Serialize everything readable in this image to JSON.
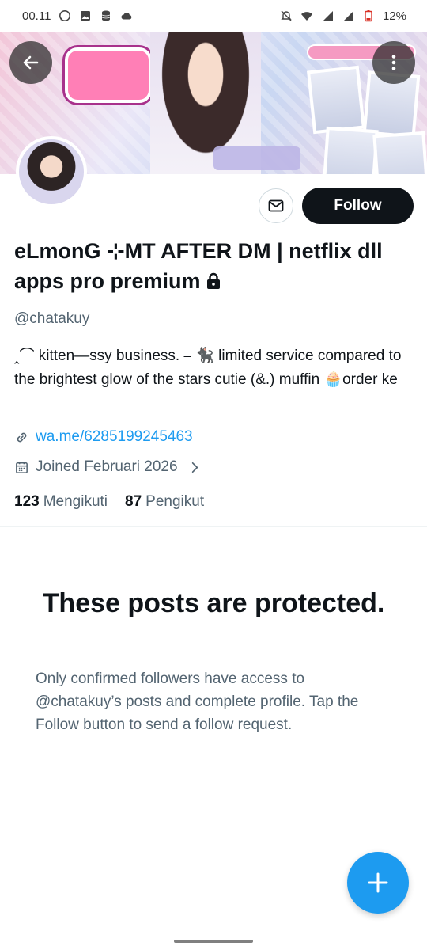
{
  "status_bar": {
    "time": "00.11",
    "battery": "12%",
    "left_icons": [
      "whatsapp-icon",
      "gallery-icon",
      "database-icon",
      "cloud-icon"
    ],
    "right_icons": [
      "bell-muted-icon",
      "wifi-icon",
      "signal-icon",
      "signal-icon",
      "battery-icon"
    ]
  },
  "header": {
    "back_icon": "arrow-left-icon",
    "more_icon": "more-vertical-icon"
  },
  "profile": {
    "display_name": "eLmonG ⊹MT AFTER DM | netflix dll apps pro premium",
    "handle": "@chatakuy",
    "bio": "‸⌒ kitten—ssy business. ⎯ 🐈‍⬛ limited service compared to the brightest glow of the stars cutie (&.) muffin 🧁order ke",
    "website": "wa.me/6285199245463",
    "joined": "Joined Februari 2026",
    "following_count": "123",
    "following_label": "Mengikuti",
    "followers_count": "87",
    "followers_label": "Pengikut"
  },
  "actions": {
    "follow_label": "Follow"
  },
  "protected": {
    "title": "These posts are protected.",
    "description": "Only confirmed followers have access to @chatakuy’s posts and complete profile. Tap the Follow button to send a follow request."
  },
  "colors": {
    "accent": "#1d9bf0",
    "primary_text": "#0f1419",
    "secondary_text": "#536471",
    "follow_button": "#0f1419"
  }
}
